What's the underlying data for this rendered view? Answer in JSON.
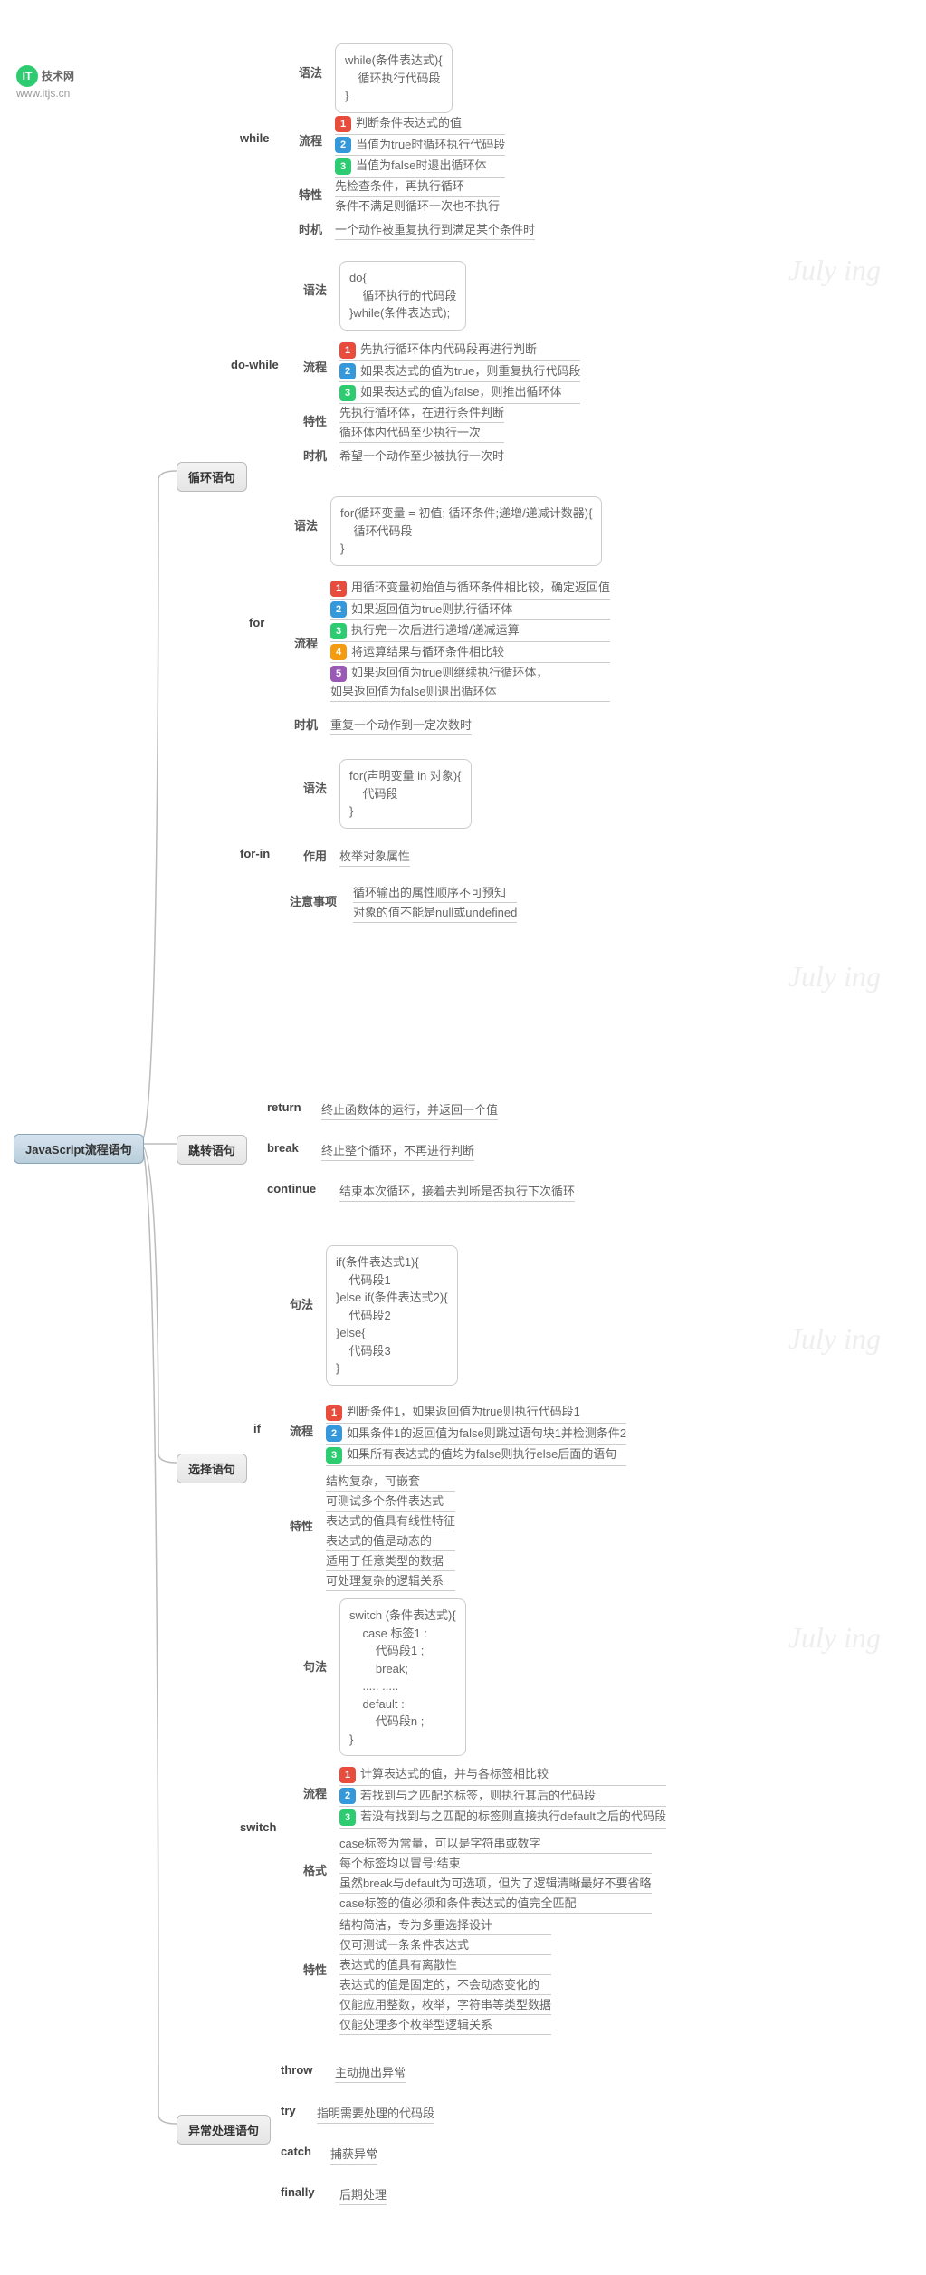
{
  "root": "JavaScript流程语句",
  "watermark": "July ing",
  "footer_brand": "技术网",
  "footer_url": "www.itjs.cn",
  "cats": {
    "loop": "循环语句",
    "jump": "跳转语句",
    "select": "选择语句",
    "except": "异常处理语句"
  },
  "while": {
    "name": "while",
    "syntax_lbl": "语法",
    "syntax": "while(条件表达式){\n    循环执行代码段\n}",
    "flow_lbl": "流程",
    "flow": [
      "判断条件表达式的值",
      "当值为true时循环执行代码段",
      "当值为false时退出循环体"
    ],
    "trait_lbl": "特性",
    "trait": [
      "先检查条件，再执行循环",
      "条件不满足则循环一次也不执行"
    ],
    "timing_lbl": "时机",
    "timing": "一个动作被重复执行到满足某个条件时"
  },
  "dowhile": {
    "name": "do-while",
    "syntax_lbl": "语法",
    "syntax": "do{\n    循环执行的代码段\n}while(条件表达式);",
    "flow_lbl": "流程",
    "flow": [
      "先执行循环体内代码段再进行判断",
      "如果表达式的值为true，则重复执行代码段",
      "如果表达式的值为false，则推出循环体"
    ],
    "trait_lbl": "特性",
    "trait": [
      "先执行循环体，在进行条件判断",
      "循环体内代码至少执行一次"
    ],
    "timing_lbl": "时机",
    "timing": "希望一个动作至少被执行一次时"
  },
  "for": {
    "name": "for",
    "syntax_lbl": "语法",
    "syntax": "for(循环变量 = 初值; 循环条件;递增/递减计数器){\n    循环代码段\n}",
    "flow_lbl": "流程",
    "flow": [
      "用循环变量初始值与循环条件相比较，确定返回值",
      "如果返回值为true则执行循环体",
      "执行完一次后进行递增/递减运算",
      "将运算结果与循环条件相比较",
      "如果返回值为true则继续执行循环体，\n如果返回值为false则退出循环体"
    ],
    "timing_lbl": "时机",
    "timing": "重复一个动作到一定次数时"
  },
  "forin": {
    "name": "for-in",
    "syntax_lbl": "语法",
    "syntax": "for(声明变量 in 对象){\n    代码段\n}",
    "use_lbl": "作用",
    "use": "枚举对象属性",
    "note_lbl": "注意事项",
    "note": [
      "循环输出的属性顺序不可预知",
      "对象的值不能是null或undefined"
    ]
  },
  "jump": {
    "return": "return",
    "return_t": "终止函数体的运行，并返回一个值",
    "break": "break",
    "break_t": "终止整个循环，不再进行判断",
    "continue": "continue",
    "continue_t": "结束本次循环，接着去判断是否执行下次循环"
  },
  "if": {
    "name": "if",
    "syntax_lbl": "句法",
    "syntax": "if(条件表达式1){\n    代码段1\n}else if(条件表达式2){\n    代码段2\n}else{\n    代码段3\n}",
    "flow_lbl": "流程",
    "flow": [
      "判断条件1，如果返回值为true则执行代码段1",
      "如果条件1的返回值为false则跳过语句块1并检测条件2",
      "如果所有表达式的值均为false则执行else后面的语句"
    ],
    "trait_lbl": "特性",
    "trait": [
      "结构复杂，可嵌套",
      "可测试多个条件表达式",
      "表达式的值具有线性特征",
      "表达式的值是动态的",
      "适用于任意类型的数据",
      "可处理复杂的逻辑关系"
    ]
  },
  "switch": {
    "name": "switch",
    "syntax_lbl": "句法",
    "syntax": "switch (条件表达式){\n    case 标签1 :\n        代码段1 ;\n        break;\n    ..... .....\n    default :\n        代码段n ;\n}",
    "flow_lbl": "流程",
    "flow": [
      "计算表达式的值，并与各标签相比较",
      "若找到与之匹配的标签，则执行其后的代码段",
      "若没有找到与之匹配的标签则直接执行default之后的代码段"
    ],
    "format_lbl": "格式",
    "format": [
      "case标签为常量，可以是字符串或数字",
      "每个标签均以冒号:结束",
      "虽然break与default为可选项，但为了逻辑清晰最好不要省略",
      "case标签的值必须和条件表达式的值完全匹配"
    ],
    "trait_lbl": "特性",
    "trait": [
      "结构简洁，专为多重选择设计",
      "仅可测试一条条件表达式",
      "表达式的值具有离散性",
      "表达式的值是固定的，不会动态变化的",
      "仅能应用整数，枚举，字符串等类型数据",
      "仅能处理多个枚举型逻辑关系"
    ]
  },
  "except": {
    "throw": "throw",
    "throw_t": "主动抛出异常",
    "try": "try",
    "try_t": "指明需要处理的代码段",
    "catch": "catch",
    "catch_t": "捕获异常",
    "finally": "finally",
    "finally_t": "后期处理"
  }
}
